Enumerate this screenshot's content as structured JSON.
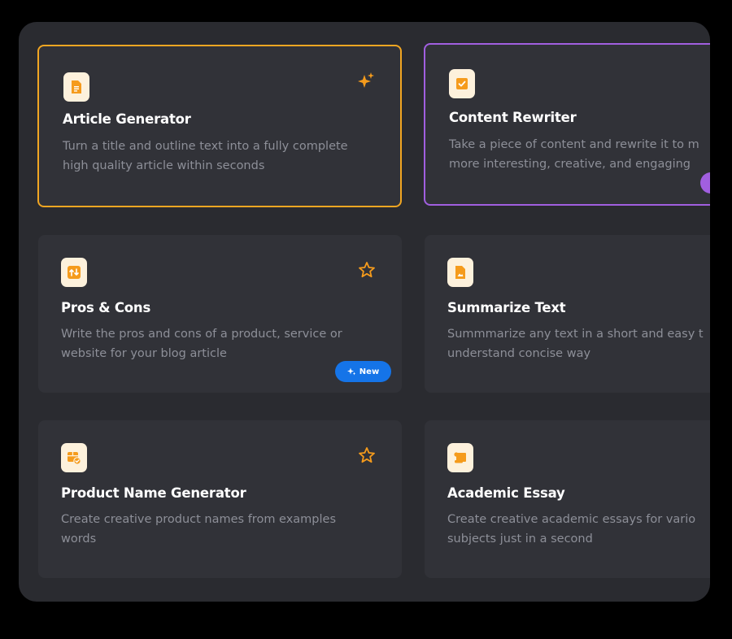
{
  "cards": [
    {
      "title": "Article Generator",
      "desc_lines": [
        "Turn a title and outline text into a fully complete",
        "high quality article within seconds"
      ],
      "icon": "document-icon",
      "action_icon": "sparkles-icon",
      "state": "selected"
    },
    {
      "title": "Content Rewriter",
      "desc_lines": [
        "Take a piece of content and rewrite it to m",
        "more interesting, creative, and engaging"
      ],
      "icon": "checkbox-icon",
      "state": "selected"
    },
    {
      "title": "Pros & Cons",
      "desc_lines": [
        "Write the pros and cons of a product, service or",
        "website for your blog article"
      ],
      "icon": "swap-icon",
      "action_icon": "star-outline-icon",
      "badge": "New"
    },
    {
      "title": "Summarize Text",
      "desc_lines": [
        "Summmarize any text in a short and easy t",
        "understand concise way"
      ],
      "icon": "file-image-icon"
    },
    {
      "title": "Product Name Generator",
      "desc_lines": [
        "Create creative product names from examples",
        "words"
      ],
      "icon": "box-check-icon",
      "action_icon": "star-outline-icon"
    },
    {
      "title": "Academic Essay",
      "desc_lines": [
        "Create creative academic essays for vario",
        "subjects just in a second"
      ],
      "icon": "scroll-icon"
    }
  ],
  "colors": {
    "accent_orange": "#f59b1c",
    "accent_purple": "#a15fe0",
    "badge_blue": "#1574e8",
    "card_bg": "#313238",
    "panel_bg": "#2a2b30"
  }
}
